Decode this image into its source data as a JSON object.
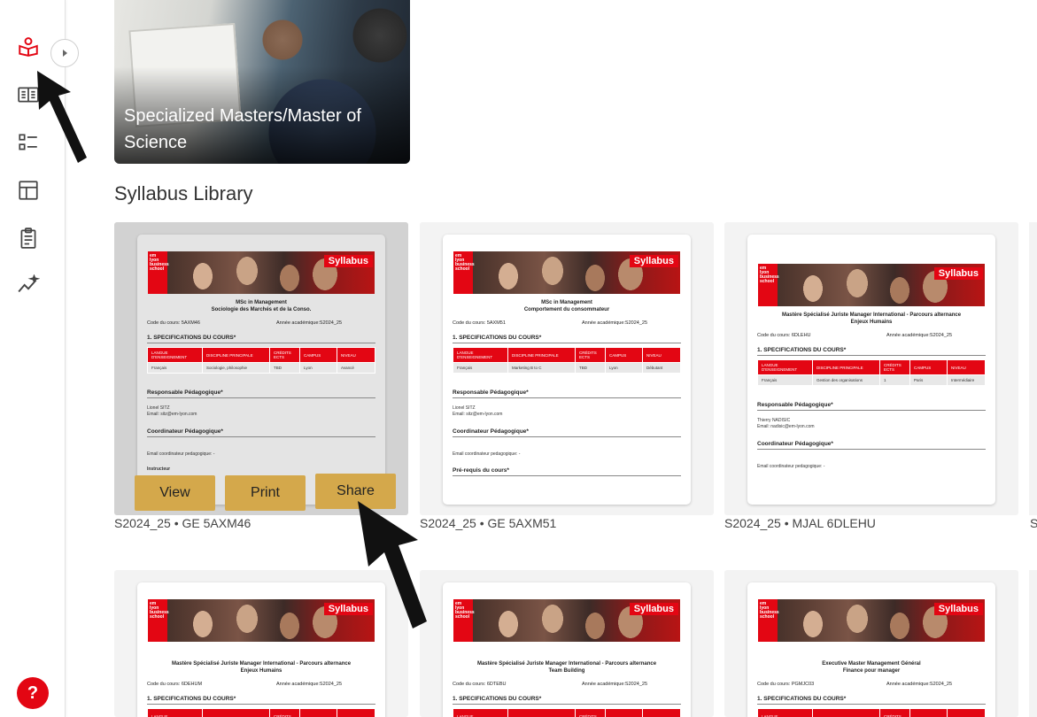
{
  "sidebar": {
    "icons": [
      "syllabus-reader-icon",
      "open-book-icon",
      "checklist-icon",
      "layout-icon",
      "clipboard-icon",
      "analytics-icon"
    ],
    "accent": "#e30613",
    "help_label": "?"
  },
  "hero": {
    "title": "Specialized Masters/Master of Science"
  },
  "library": {
    "title": "Syllabus Library"
  },
  "actions": {
    "view": "View",
    "print": "Print",
    "share": "Share"
  },
  "cards": [
    {
      "caption": "S2024_25 • GE 5AXM46",
      "banner_tag": "Syllabus",
      "doc_title_1": "MSc in Management",
      "doc_title_2": "Sociologie des Marchés et de la Conso.",
      "code_label": "Code du cours: 5AXM46",
      "year_label": "Année académique:S2024_25",
      "section_1": "1. SPECIFICATIONS DU COURS*",
      "headers": [
        "LANGUE D'ENSEIGNEMENT",
        "DISCIPLINE PRINCIPALE",
        "CRÉDITS ECTS",
        "CAMPUS",
        "NIVEAU"
      ],
      "row": [
        "Français",
        "Sociologie, philosophie",
        "TBD",
        "Lyon",
        "Avancé"
      ],
      "resp_title": "Responsable Pédagogique*",
      "resp_name": "Lionel SITZ",
      "resp_email": "Email: sitz@em-lyon.com",
      "coord_title": "Coordinateur Pédagogique*",
      "coord_email": "Email coordinateur pedagogique: -",
      "extra": "Instructeur"
    },
    {
      "caption": "S2024_25 • GE 5AXM51",
      "banner_tag": "Syllabus",
      "doc_title_1": "MSc in Management",
      "doc_title_2": "Comportement du consommateur",
      "code_label": "Code du cours: 5AXM51",
      "year_label": "Année académique:S2024_25",
      "section_1": "1. SPECIFICATIONS DU COURS*",
      "headers": [
        "LANGUE D'ENSEIGNEMENT",
        "DISCIPLINE PRINCIPALE",
        "CRÉDITS ECTS",
        "CAMPUS",
        "NIVEAU"
      ],
      "row": [
        "Français",
        "Marketing B to C",
        "TBD",
        "Lyon",
        "Débutant"
      ],
      "resp_title": "Responsable Pédagogique*",
      "resp_name": "Lionel SITZ",
      "resp_email": "Email: sitz@em-lyon.com",
      "coord_title": "Coordinateur Pédagogique*",
      "coord_email": "Email coordinateur pedagogique: -",
      "extra": "Pré-requis du cours*"
    },
    {
      "caption": "S2024_25 • MJAL 6DLEHU",
      "banner_tag": "Syllabus",
      "doc_title_1": "Mastère Spécialisé Juriste Manager International - Parcours alternance",
      "doc_title_2": "Enjeux Humains",
      "code_label": "Code du cours: 6DLEHU",
      "year_label": "Année académique:S2024_25",
      "section_1": "1. SPECIFICATIONS DU COURS*",
      "headers": [
        "LANGUE D'ENSEIGNEMENT",
        "DISCIPLINE PRINCIPALE",
        "CRÉDITS ECTS",
        "CAMPUS",
        "NIVEAU"
      ],
      "row": [
        "Français",
        "Gestion des organisations",
        "1",
        "Paris",
        "Intermédiaire"
      ],
      "resp_title": "Responsable Pédagogique*",
      "resp_name": "Thierry NADISIC",
      "resp_email": "Email: nadisic@em-lyon.com",
      "coord_title": "Coordinateur Pédagogique*",
      "coord_email": "Email coordinateur pedagogique: -",
      "extra": ""
    },
    {
      "caption": "",
      "banner_tag": "Syllabus",
      "doc_title_1": "Mastère Spécialisé Juriste Manager International - Parcours alternance",
      "doc_title_2": "Enjeux Humains",
      "code_label": "Code du cours: 6DEHUM",
      "year_label": "Année académique:S2024_25",
      "section_1": "1. SPECIFICATIONS DU COURS*",
      "headers": [
        "LANGUE",
        "",
        "CRÉDITS",
        "",
        ""
      ]
    },
    {
      "caption": "",
      "banner_tag": "Syllabus",
      "doc_title_1": "Mastère Spécialisé Juriste Manager International - Parcours alternance",
      "doc_title_2": "Team Building",
      "code_label": "Code du cours: 6DTEBU",
      "year_label": "Année académique:S2024_25",
      "section_1": "1. SPECIFICATIONS DU COURS*",
      "headers": [
        "LANGUE",
        "",
        "CRÉDITS",
        "",
        ""
      ]
    },
    {
      "caption": "",
      "banner_tag": "Syllabus",
      "doc_title_1": "Executive Master Management Général",
      "doc_title_2": "Finance pour manager",
      "code_label": "Code du cours: PGMJC03",
      "year_label": "Année académique:S2024_25",
      "section_1": "1. SPECIFICATIONS DU COURS*",
      "headers": [
        "LANGUE",
        "",
        "CRÉDITS",
        "",
        ""
      ]
    }
  ],
  "partial_caption": "S"
}
